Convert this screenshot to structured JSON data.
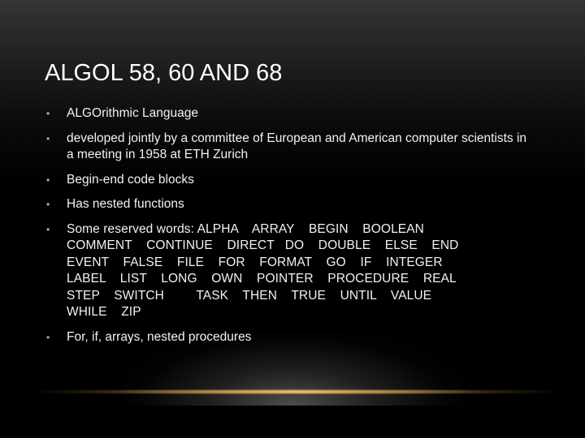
{
  "slide": {
    "title": "ALGOL 58, 60 AND 68",
    "bullet_glyph": "•",
    "colors": {
      "title": "#ffffff",
      "text": "#f2f2f2",
      "bullet": "#c8b08a",
      "accent_line": "#d9a85a",
      "background_top": "#353535",
      "background_bottom": "#000000"
    },
    "bullets": [
      {
        "text": "ALGOrithmic Language"
      },
      {
        "text": "developed jointly by a committee of European and American computer scientists in a meeting in 1958 at ETH Zurich"
      },
      {
        "text": "Begin-end code blocks"
      },
      {
        "text": "Has nested functions"
      },
      {
        "text": "Some reserved words: ALPHA    ARRAY    BEGIN    BOOLEAN\nCOMMENT    CONTINUE    DIRECT   DO    DOUBLE    ELSE    END\nEVENT    FALSE    FILE    FOR    FORMAT    GO    IF    INTEGER\nLABEL    LIST    LONG    OWN    POINTER    PROCEDURE    REAL\nSTEP    SWITCH         TASK    THEN    TRUE    UNTIL    VALUE\nWHILE    ZIP"
      },
      {
        "text": "For, if, arrays, nested procedures"
      }
    ]
  }
}
